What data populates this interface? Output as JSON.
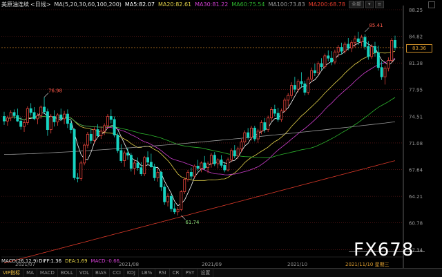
{
  "header": {
    "symbol": "美原油连续",
    "period": "<日线>",
    "ma_params": "MA(5,20,30,60,100,200)",
    "ma5": "MA5:82.07",
    "ma20": "MA20:82.61",
    "ma30": "MA30:81.22",
    "ma60": "MA60:75.54",
    "ma100": "MA100:73.83",
    "ma200": "MA200:68.78"
  },
  "toolbar": {
    "all_label": "全部",
    "btn1": "▾",
    "btn2": "≡"
  },
  "current_price": "83.36",
  "macd": {
    "label": "MACD(26,12,9)",
    "diff": "DIFF:1.36",
    "dea": "DEA:1.69",
    "macd": "MACD:-0.66"
  },
  "tabs": [
    "VIP指标",
    "MA",
    "MACD",
    "BOLL",
    "VOL",
    "BIAS",
    "CCI",
    "KDJ",
    "LB%",
    "RSI",
    "CR",
    "PSY",
    "设置"
  ],
  "watermark": "FX678",
  "colors": {
    "up": "#e8453c",
    "down": "#17d4c2",
    "ma5": "#ffffff",
    "ma20": "#e6d44a",
    "ma30": "#d23fd2",
    "ma60": "#2eb82e",
    "ma100": "#9a9a9a",
    "ma200": "#e03a2a",
    "grid": "#7a2020",
    "axis": "#9a9a9a",
    "orange": "#e0902a"
  },
  "chart_data": {
    "type": "candlestick",
    "ylim": [
      55.5,
      88.25
    ],
    "y_ticks": [
      "88.25",
      "84.82",
      "81.38",
      "77.95",
      "74.51",
      "71.08",
      "67.64",
      "64.21",
      "60.78",
      "57.34"
    ],
    "x_labels": [
      "2021/07",
      "2021/08",
      "2021/09",
      "2021/10",
      "2021/11/10 星期三"
    ],
    "annotations": [
      {
        "label": "76.98",
        "value": 76.98,
        "bar": 12
      },
      {
        "label": "61.74",
        "value": 61.74,
        "bar": 53
      },
      {
        "label": "85.41",
        "value": 85.41,
        "bar": 108
      }
    ],
    "ohlc": [
      [
        74.5,
        75.1,
        73.4,
        73.9
      ],
      [
        73.9,
        74.6,
        73.3,
        74.3
      ],
      [
        74.3,
        75.3,
        73.9,
        75.0
      ],
      [
        75.0,
        75.4,
        74.2,
        74.6
      ],
      [
        74.6,
        75.5,
        73.8,
        73.9
      ],
      [
        73.9,
        74.4,
        72.8,
        73.2
      ],
      [
        73.2,
        74.0,
        72.5,
        73.7
      ],
      [
        73.7,
        75.8,
        73.4,
        75.5
      ],
      [
        75.5,
        76.2,
        74.6,
        75.0
      ],
      [
        75.0,
        75.7,
        74.0,
        74.2
      ],
      [
        74.2,
        74.9,
        73.5,
        74.6
      ],
      [
        74.6,
        75.9,
        74.2,
        75.7
      ],
      [
        75.7,
        76.98,
        74.8,
        75.1
      ],
      [
        75.1,
        75.5,
        72.0,
        72.8
      ],
      [
        72.8,
        74.8,
        72.3,
        74.5
      ],
      [
        74.5,
        75.3,
        73.2,
        73.8
      ],
      [
        73.8,
        74.9,
        73.3,
        74.7
      ],
      [
        74.7,
        75.5,
        73.9,
        74.2
      ],
      [
        74.2,
        75.2,
        73.5,
        74.8
      ],
      [
        74.8,
        75.4,
        73.0,
        73.6
      ],
      [
        73.6,
        74.0,
        72.3,
        72.8
      ],
      [
        72.8,
        73.0,
        66.3,
        66.6
      ],
      [
        66.6,
        67.2,
        66.0,
        66.5
      ],
      [
        66.5,
        68.8,
        66.2,
        68.5
      ],
      [
        68.5,
        71.0,
        68.2,
        70.8
      ],
      [
        70.8,
        72.5,
        70.4,
        72.2
      ],
      [
        72.2,
        72.9,
        71.0,
        71.4
      ],
      [
        71.4,
        73.1,
        71.0,
        72.8
      ],
      [
        72.8,
        73.5,
        71.8,
        72.0
      ],
      [
        72.0,
        73.2,
        71.6,
        72.6
      ],
      [
        72.6,
        73.6,
        72.1,
        73.3
      ],
      [
        73.3,
        74.8,
        72.9,
        74.5
      ],
      [
        74.5,
        75.4,
        73.6,
        74.1
      ],
      [
        74.1,
        74.5,
        71.8,
        72.1
      ],
      [
        72.1,
        72.4,
        69.8,
        70.1
      ],
      [
        70.1,
        70.9,
        68.5,
        68.8
      ],
      [
        68.8,
        70.1,
        68.0,
        69.8
      ],
      [
        69.8,
        70.5,
        68.9,
        69.5
      ],
      [
        69.5,
        69.8,
        67.4,
        67.8
      ],
      [
        67.8,
        68.9,
        67.0,
        68.5
      ],
      [
        68.5,
        69.2,
        67.5,
        67.9
      ],
      [
        67.9,
        68.6,
        66.8,
        67.1
      ],
      [
        67.1,
        69.4,
        66.8,
        69.2
      ],
      [
        69.2,
        70.0,
        68.2,
        68.6
      ],
      [
        68.6,
        69.7,
        67.9,
        68.0
      ],
      [
        68.0,
        68.4,
        66.2,
        66.6
      ],
      [
        66.6,
        67.8,
        66.1,
        67.3
      ],
      [
        67.3,
        67.5,
        64.9,
        65.4
      ],
      [
        65.4,
        65.8,
        63.1,
        63.5
      ],
      [
        63.5,
        64.6,
        62.9,
        64.2
      ],
      [
        64.2,
        64.5,
        62.2,
        62.6
      ],
      [
        62.6,
        63.3,
        61.9,
        62.2
      ],
      [
        62.2,
        62.8,
        61.74,
        62.5
      ],
      [
        62.5,
        65.0,
        62.3,
        64.8
      ],
      [
        64.8,
        66.6,
        64.5,
        66.4
      ],
      [
        66.4,
        67.6,
        66.1,
        67.3
      ],
      [
        67.3,
        67.9,
        66.4,
        66.8
      ],
      [
        66.8,
        68.3,
        66.5,
        68.1
      ],
      [
        68.1,
        68.9,
        67.4,
        67.8
      ],
      [
        67.8,
        68.7,
        67.3,
        68.5
      ],
      [
        68.5,
        69.4,
        67.6,
        67.9
      ],
      [
        67.9,
        68.7,
        67.2,
        68.4
      ],
      [
        68.4,
        69.8,
        67.9,
        69.5
      ],
      [
        69.5,
        69.9,
        68.1,
        68.4
      ],
      [
        68.4,
        69.1,
        67.8,
        68.9
      ],
      [
        68.9,
        69.5,
        67.9,
        68.2
      ],
      [
        68.2,
        68.6,
        67.3,
        67.6
      ],
      [
        67.6,
        69.2,
        67.4,
        68.9
      ],
      [
        68.9,
        70.4,
        68.6,
        70.1
      ],
      [
        70.1,
        70.8,
        69.1,
        69.4
      ],
      [
        69.4,
        70.6,
        69.0,
        70.3
      ],
      [
        70.3,
        71.6,
        69.9,
        71.2
      ],
      [
        71.2,
        72.7,
        70.8,
        72.4
      ],
      [
        72.4,
        73.0,
        71.5,
        71.8
      ],
      [
        71.8,
        73.3,
        71.4,
        73.0
      ],
      [
        73.0,
        73.3,
        71.3,
        71.6
      ],
      [
        71.6,
        72.9,
        71.1,
        72.6
      ],
      [
        72.6,
        74.0,
        72.2,
        73.7
      ],
      [
        73.7,
        74.3,
        72.4,
        72.8
      ],
      [
        72.8,
        74.6,
        72.5,
        74.3
      ],
      [
        74.3,
        75.7,
        73.9,
        75.4
      ],
      [
        75.4,
        76.0,
        74.5,
        74.9
      ],
      [
        74.9,
        75.6,
        73.8,
        74.1
      ],
      [
        74.1,
        75.5,
        73.8,
        75.2
      ],
      [
        75.2,
        76.9,
        75.0,
        76.6
      ],
      [
        76.6,
        77.5,
        75.8,
        77.2
      ],
      [
        77.2,
        78.9,
        76.8,
        78.5
      ],
      [
        78.5,
        79.6,
        77.6,
        78.0
      ],
      [
        78.0,
        79.3,
        77.6,
        79.0
      ],
      [
        79.0,
        80.2,
        78.2,
        78.7
      ],
      [
        78.7,
        79.1,
        77.2,
        77.6
      ],
      [
        77.6,
        79.6,
        77.3,
        79.3
      ],
      [
        79.3,
        80.8,
        78.9,
        80.4
      ],
      [
        80.4,
        81.3,
        79.7,
        80.1
      ],
      [
        80.1,
        81.6,
        79.8,
        81.3
      ],
      [
        81.3,
        82.0,
        80.5,
        80.9
      ],
      [
        80.9,
        82.6,
        80.6,
        82.3
      ],
      [
        82.3,
        83.0,
        81.6,
        82.0
      ],
      [
        82.0,
        82.9,
        81.1,
        81.5
      ],
      [
        81.5,
        83.1,
        81.2,
        82.8
      ],
      [
        82.8,
        83.7,
        82.1,
        83.4
      ],
      [
        83.4,
        84.0,
        82.5,
        82.9
      ],
      [
        82.9,
        84.1,
        82.6,
        83.8
      ],
      [
        83.8,
        84.6,
        83.0,
        83.3
      ],
      [
        83.3,
        84.3,
        82.8,
        84.0
      ],
      [
        84.0,
        84.9,
        83.4,
        84.5
      ],
      [
        84.5,
        85.41,
        83.7,
        84.1
      ],
      [
        84.1,
        85.0,
        83.5,
        84.7
      ],
      [
        84.7,
        85.1,
        83.1,
        83.5
      ],
      [
        83.5,
        84.2,
        81.8,
        82.2
      ],
      [
        82.2,
        83.8,
        81.9,
        83.5
      ],
      [
        83.5,
        84.1,
        82.2,
        82.7
      ],
      [
        82.7,
        83.6,
        80.4,
        80.8
      ],
      [
        80.8,
        81.6,
        79.2,
        79.6
      ],
      [
        79.6,
        81.0,
        78.6,
        80.7
      ],
      [
        80.7,
        82.1,
        80.3,
        81.7
      ],
      [
        81.7,
        84.6,
        81.4,
        84.3
      ],
      [
        84.3,
        84.9,
        83.0,
        83.36
      ]
    ]
  }
}
